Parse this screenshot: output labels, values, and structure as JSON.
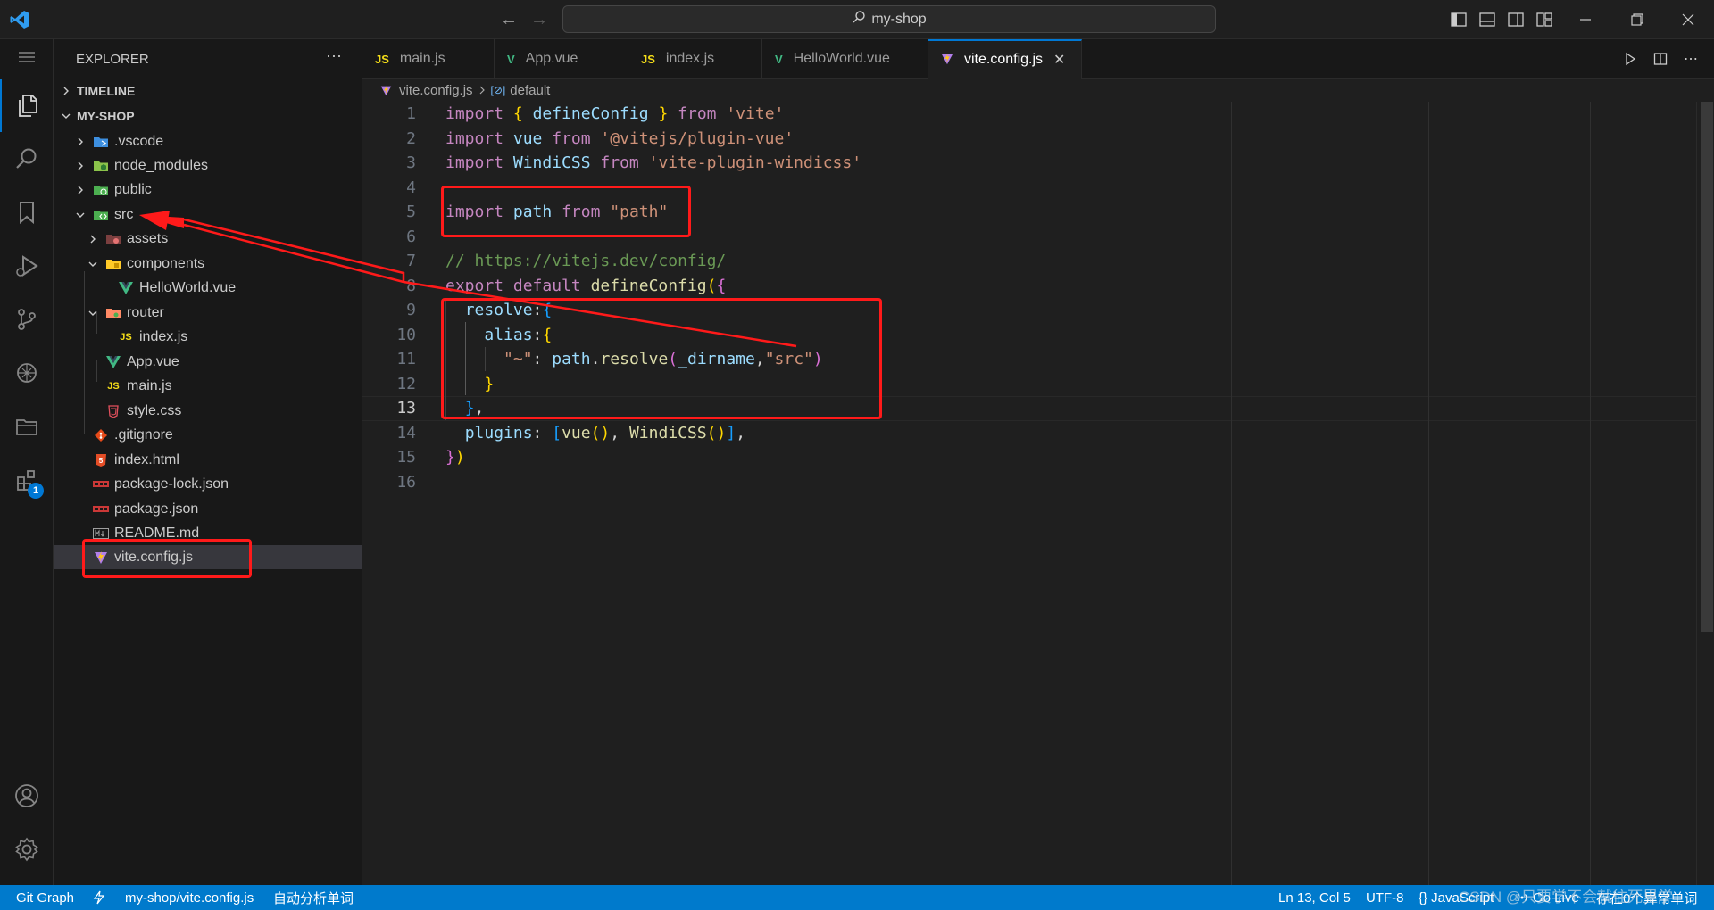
{
  "titlebar": {
    "search_text": "my-shop"
  },
  "activity": {
    "extensions_badge": "1"
  },
  "sidebar": {
    "title": "EXPLORER",
    "more": "···",
    "timeline_label": "TIMELINE",
    "project_label": "MY-SHOP",
    "items": [
      {
        "label": ".vscode",
        "icon": "vscode-folder-icon",
        "color": "#3d8fe0"
      },
      {
        "label": "node_modules",
        "icon": "node-folder-icon",
        "color": "#8bc34a"
      },
      {
        "label": "public",
        "icon": "public-folder-icon",
        "color": "#4caf50"
      },
      {
        "label": "src",
        "icon": "src-folder-icon",
        "color": "#4caf50"
      },
      {
        "label": "assets",
        "icon": "assets-folder-icon",
        "color": "#e57373"
      },
      {
        "label": "components",
        "icon": "components-folder-icon",
        "color": "#ffca28"
      },
      {
        "label": "HelloWorld.vue",
        "icon": "vue-file-icon",
        "color": "#41b883"
      },
      {
        "label": "router",
        "icon": "router-folder-icon",
        "color": "#ff8a65"
      },
      {
        "label": "index.js",
        "icon": "js-file-icon",
        "color": "#f5de19"
      },
      {
        "label": "App.vue",
        "icon": "vue-file-icon",
        "color": "#41b883"
      },
      {
        "label": "main.js",
        "icon": "js-file-icon",
        "color": "#f5de19"
      },
      {
        "label": "style.css",
        "icon": "css-file-icon",
        "color": "#e14f5c"
      },
      {
        "label": ".gitignore",
        "icon": "git-file-icon",
        "color": "#e64a19"
      },
      {
        "label": "index.html",
        "icon": "html-file-icon",
        "color": "#e44d26"
      },
      {
        "label": "package-lock.json",
        "icon": "npm-file-icon",
        "color": "#cb3837"
      },
      {
        "label": "package.json",
        "icon": "npm-file-icon",
        "color": "#cb3837"
      },
      {
        "label": "README.md",
        "icon": "markdown-file-icon",
        "color": "#9e9e9e"
      },
      {
        "label": "vite.config.js",
        "icon": "vite-file-icon",
        "color": "#ffc517"
      }
    ]
  },
  "tabs": [
    {
      "label": "main.js",
      "icon_text": "JS",
      "icon": "js-file-icon",
      "color": "#f5de19"
    },
    {
      "label": "App.vue",
      "icon_text": "V",
      "icon": "vue-file-icon",
      "color": "#41b883"
    },
    {
      "label": "index.js",
      "icon_text": "JS",
      "icon": "js-file-icon",
      "color": "#f5de19"
    },
    {
      "label": "HelloWorld.vue",
      "icon_text": "V",
      "icon": "vue-file-icon",
      "color": "#41b883"
    },
    {
      "label": "vite.config.js",
      "icon_text": "V",
      "icon": "vite-file-icon",
      "color": "#b37feb"
    }
  ],
  "tab_close": "✕",
  "breadcrumb": {
    "file": "vite.config.js",
    "symbol": "default"
  },
  "editor": {
    "current_line": 13,
    "lines": [
      [
        [
          "kw",
          "import"
        ],
        [
          "pl",
          " "
        ],
        [
          "br1",
          "{"
        ],
        [
          "pl",
          " "
        ],
        [
          "var",
          "defineConfig"
        ],
        [
          "pl",
          " "
        ],
        [
          "br1",
          "}"
        ],
        [
          "pl",
          " "
        ],
        [
          "kw",
          "from"
        ],
        [
          "pl",
          " "
        ],
        [
          "str",
          "'vite'"
        ]
      ],
      [
        [
          "kw",
          "import"
        ],
        [
          "pl",
          " "
        ],
        [
          "var",
          "vue"
        ],
        [
          "pl",
          " "
        ],
        [
          "kw",
          "from"
        ],
        [
          "pl",
          " "
        ],
        [
          "str",
          "'@vitejs/plugin-vue'"
        ]
      ],
      [
        [
          "kw",
          "import"
        ],
        [
          "pl",
          " "
        ],
        [
          "var",
          "WindiCSS"
        ],
        [
          "pl",
          " "
        ],
        [
          "kw",
          "from"
        ],
        [
          "pl",
          " "
        ],
        [
          "str",
          "'vite-plugin-windicss'"
        ]
      ],
      [],
      [
        [
          "kw",
          "import"
        ],
        [
          "pl",
          " "
        ],
        [
          "var",
          "path"
        ],
        [
          "pl",
          " "
        ],
        [
          "kw",
          "from"
        ],
        [
          "pl",
          " "
        ],
        [
          "str",
          "\"path\""
        ]
      ],
      [],
      [
        [
          "cmt",
          "// https://vitejs.dev/config/"
        ]
      ],
      [
        [
          "kw",
          "export"
        ],
        [
          "pl",
          " "
        ],
        [
          "kw",
          "default"
        ],
        [
          "pl",
          " "
        ],
        [
          "fn",
          "defineConfig"
        ],
        [
          "br1",
          "("
        ],
        [
          "br2",
          "{"
        ]
      ],
      [
        [
          "pl",
          "  "
        ],
        [
          "var",
          "resolve"
        ],
        [
          "pl",
          ":"
        ],
        [
          "br3",
          "{"
        ]
      ],
      [
        [
          "pl",
          "    "
        ],
        [
          "var",
          "alias"
        ],
        [
          "pl",
          ":"
        ],
        [
          "br1",
          "{"
        ]
      ],
      [
        [
          "pl",
          "      "
        ],
        [
          "str",
          "\"~\""
        ],
        [
          "pl",
          ": "
        ],
        [
          "var",
          "path"
        ],
        [
          "pl",
          "."
        ],
        [
          "fn",
          "resolve"
        ],
        [
          "br2",
          "("
        ],
        [
          "var",
          "_dirname"
        ],
        [
          "pl",
          ","
        ],
        [
          "str",
          "\"src\""
        ],
        [
          "br2",
          ")"
        ]
      ],
      [
        [
          "pl",
          "    "
        ],
        [
          "br1",
          "}"
        ]
      ],
      [
        [
          "pl",
          "  "
        ],
        [
          "br3",
          "}"
        ],
        [
          "pl",
          ","
        ]
      ],
      [
        [
          "pl",
          "  "
        ],
        [
          "var",
          "plugins"
        ],
        [
          "pl",
          ": "
        ],
        [
          "br3",
          "["
        ],
        [
          "fn",
          "vue"
        ],
        [
          "br1",
          "()"
        ],
        [
          "pl",
          ", "
        ],
        [
          "fn",
          "WindiCSS"
        ],
        [
          "br1",
          "()"
        ],
        [
          "br3",
          "]"
        ],
        [
          "pl",
          ","
        ]
      ],
      [
        [
          "br2",
          "}"
        ],
        [
          "br1",
          ")"
        ]
      ],
      []
    ]
  },
  "statusbar": {
    "git_graph": "Git Graph",
    "file_path": "my-shop/vite.config.js",
    "auto_analyze": "自动分析单词",
    "position": "Ln 13, Col 5",
    "encoding": "UTF-8",
    "language": "{} JavaScript",
    "go_live": "Go Live",
    "save_remind": "存在0个异常单词"
  },
  "watermark": "CSDN @只要学不会就往死里学",
  "colors": {
    "accent": "#0078d4",
    "statusbar": "#007acc",
    "annotation": "#ff1a1a"
  }
}
